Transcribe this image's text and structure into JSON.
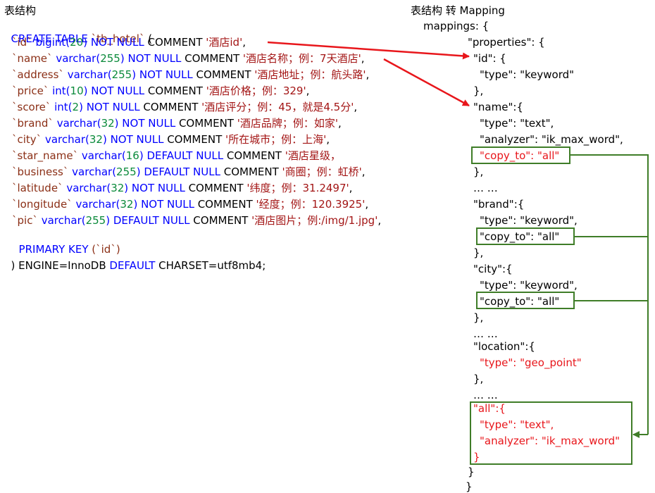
{
  "left_title": "表结构",
  "right_title": "表结构 转 Mapping",
  "sql": {
    "create": "CREATE TABLE",
    "table_name": "`tb_hotel`",
    "open_paren": " (",
    "rows": [
      {
        "field": "`id`",
        "type": "bigint(",
        "size": "20",
        "type_end": ")",
        "mods": " NOT NULL",
        "comment_kw": " COMMENT ",
        "comment": "'酒店id'",
        "tail": ","
      },
      {
        "field": "`name`",
        "type": "varchar(",
        "size": "255",
        "type_end": ")",
        "mods": " NOT NULL",
        "comment_kw": " COMMENT ",
        "comment": "'酒店名称；例：7天酒店'",
        "tail": ","
      },
      {
        "field": "`address`",
        "type": "varchar(",
        "size": "255",
        "type_end": ")",
        "mods": " NOT NULL",
        "comment_kw": " COMMENT ",
        "comment": "'酒店地址；例：航头路'",
        "tail": ","
      },
      {
        "field": "`price`",
        "type": "int(",
        "size": "10",
        "type_end": ")",
        "mods": " NOT NULL",
        "comment_kw": " COMMENT ",
        "comment": "'酒店价格；例：329'",
        "tail": ","
      },
      {
        "field": "`score`",
        "type": "int(",
        "size": "2",
        "type_end": ")",
        "mods": " NOT NULL",
        "comment_kw": " COMMENT ",
        "comment": "'酒店评分；例：45，就是4.5分'",
        "tail": ","
      },
      {
        "field": "`brand`",
        "type": "varchar(",
        "size": "32",
        "type_end": ")",
        "mods": " NOT NULL",
        "comment_kw": " COMMENT ",
        "comment": "'酒店品牌；例：如家'",
        "tail": ","
      },
      {
        "field": "`city`",
        "type": "varchar(",
        "size": "32",
        "type_end": ")",
        "mods": " NOT NULL",
        "comment_kw": " COMMENT ",
        "comment": "'所在城市；例：上海'",
        "tail": ","
      },
      {
        "field": "`star_name`",
        "type": "varchar(",
        "size": "16",
        "type_end": ")",
        "mods": " DEFAULT NULL",
        "comment_kw": " COMMENT ",
        "comment": "'酒店星级，",
        "tail": ""
      },
      {
        "field": "`business`",
        "type": "varchar(",
        "size": "255",
        "type_end": ")",
        "mods": " DEFAULT NULL",
        "comment_kw": " COMMENT ",
        "comment": "'商圈；例：虹桥'",
        "tail": ","
      },
      {
        "field": "`latitude`",
        "type": "varchar(",
        "size": "32",
        "type_end": ")",
        "mods": " NOT NULL",
        "comment_kw": " COMMENT ",
        "comment": "'纬度；例：31.2497'",
        "tail": ","
      },
      {
        "field": "`longitude`",
        "type": "varchar(",
        "size": "32",
        "type_end": ")",
        "mods": " NOT NULL",
        "comment_kw": " COMMENT ",
        "comment": "'经度；例：120.3925'",
        "tail": ","
      },
      {
        "field": "`pic`",
        "type": "varchar(",
        "size": "255",
        "type_end": ")",
        "mods": " DEFAULT NULL",
        "comment_kw": " COMMENT ",
        "comment": "'酒店图片；例:/img/1.jpg'",
        "tail": ","
      }
    ],
    "primary_key": "PRIMARY KEY",
    "primary_key_field": " (`id`)",
    "engine_prefix": ") ENGINE=InnoDB ",
    "engine_default": "DEFAULT",
    "engine_charset": " CHARSET=utf8mb4;"
  },
  "mapping_lines": [
    "mappings: {",
    "\"properties\": {",
    "\"id\": {",
    "\"type\": \"keyword\"",
    "},",
    "\"name\":{",
    "\"type\": \"text\",",
    "\"analyzer\": \"ik_max_word\",",
    "\"copy_to\": \"all\"",
    "},",
    "… …",
    "\"brand\":{",
    "\"type\": \"keyword\",",
    "\"copy_to\": \"all\"",
    "},",
    "\"city\":{",
    "\"type\": \"keyword\",",
    "\"copy_to\": \"all\"",
    "},",
    "… …",
    "\"location\":{",
    "\"type\": \"geo_point\"",
    "},",
    "… …",
    "\"all\":{",
    "\"type\": \"text\",",
    "\"analyzer\": \"ik_max_word\"",
    "}",
    "}",
    "}"
  ],
  "colors": {
    "keyword": "#0000ff",
    "field": "#8b2f16",
    "number": "#0a8a3a",
    "string": "#a31515",
    "highlight": "#e8161b",
    "box": "#3f7d28"
  }
}
